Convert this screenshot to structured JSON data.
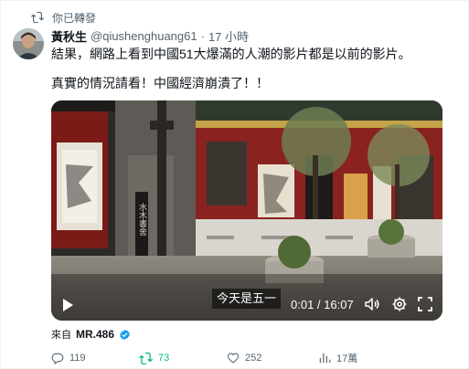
{
  "social_context": {
    "label": "你已轉發"
  },
  "author": {
    "display_name": "黃秋生",
    "handle": "@qiushenghuang61",
    "timestamp": "17 小時"
  },
  "post": {
    "line1": "結果，網路上看到中國51大爆滿的人潮的影片都是以前的影片。",
    "line2": "真實的情況請看！中國經濟崩潰了！！"
  },
  "video": {
    "caption": "今天是五一",
    "time": "0:01 / 16:07",
    "sign_text": "水木書舍"
  },
  "attribution": {
    "prefix": "來自",
    "source": "MR.486"
  },
  "actions": {
    "replies": "119",
    "reposts": "73",
    "likes": "252",
    "views": "17萬"
  },
  "colors": {
    "verified": "#1d9bf0",
    "repost_active": "#00ba7c",
    "secondary_text": "#536471"
  }
}
